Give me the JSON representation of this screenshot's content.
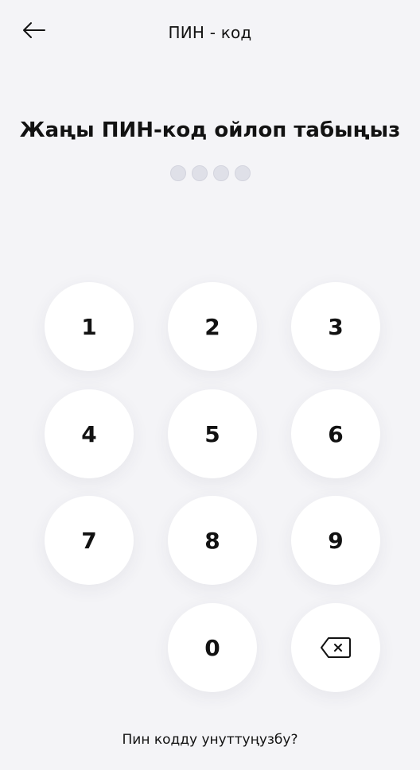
{
  "header": {
    "title": "ПИН - код",
    "back_icon": "arrow-left-icon"
  },
  "prompt": "Жаңы ПИН-код ойлоп табыңыз",
  "pin": {
    "length": 4,
    "entered": 0
  },
  "keypad": {
    "keys": [
      "1",
      "2",
      "3",
      "4",
      "5",
      "6",
      "7",
      "8",
      "9",
      "0"
    ],
    "backspace_icon": "backspace-icon"
  },
  "forgot_link": "Пин кодду унуттуңузбу?",
  "colors": {
    "background": "#f4f4f7",
    "key_background": "#ffffff",
    "dot_empty": "#dfe0e8",
    "text": "#121212"
  }
}
